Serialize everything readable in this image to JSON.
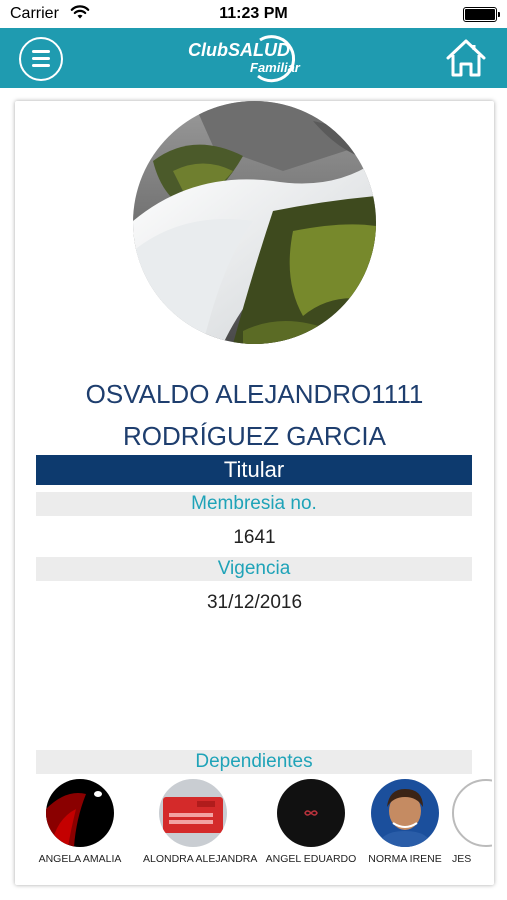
{
  "status_bar": {
    "carrier": "Carrier",
    "time": "11:23 PM"
  },
  "nav": {
    "logo_main": "ClubSALUD",
    "logo_sub": "Familiar",
    "icons": {
      "menu": "menu-icon",
      "home": "home-icon"
    }
  },
  "profile": {
    "name_line1": "OSVALDO ALEJANDRO1111",
    "name_line2": "RODRÍGUEZ GARCIA",
    "role": "Titular",
    "membership_label": "Membresia no.",
    "membership_number": "1641",
    "validity_label": "Vigencia",
    "validity_date": "31/12/2016"
  },
  "dependents": {
    "label": "Dependientes",
    "items": [
      {
        "name": "ANGELA AMALIA"
      },
      {
        "name": "ALONDRA ALEJANDRA"
      },
      {
        "name": "ANGEL EDUARDO"
      },
      {
        "name": "NORMA IRENE"
      },
      {
        "name": "JES"
      }
    ]
  },
  "colors": {
    "nav_background": "#1f9bb0",
    "title_text": "#1e3e6e",
    "role_band": "#0d3a6e",
    "label_text": "#1fa3b8"
  }
}
